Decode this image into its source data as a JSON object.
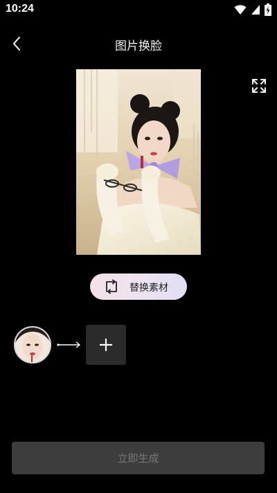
{
  "status_bar": {
    "time": "10:24",
    "icons": [
      "wifi-icon",
      "signal-icon",
      "battery-charging-icon"
    ]
  },
  "nav": {
    "back_icon": "back-chevron-icon",
    "title": "图片换脸",
    "expand_icon": "fullscreen-expand-icon"
  },
  "main": {
    "photo_alt": "template photo",
    "replace_button": {
      "icon": "replace-icon",
      "label": "替换素材"
    }
  },
  "face_swap": {
    "source_face": "face-thumbnail",
    "arrow_icon": "long-arrow-right-icon",
    "add_icon": "plus-icon"
  },
  "footer": {
    "generate_label": "立即生成"
  },
  "colors": {
    "background": "#000000",
    "generate_button_bg": "#3d3d3d",
    "generate_button_text": "#777777",
    "add_button_bg": "#2b2b2b",
    "replace_button_gradient": [
      "#f3e2e8",
      "#e1ddf4"
    ]
  }
}
